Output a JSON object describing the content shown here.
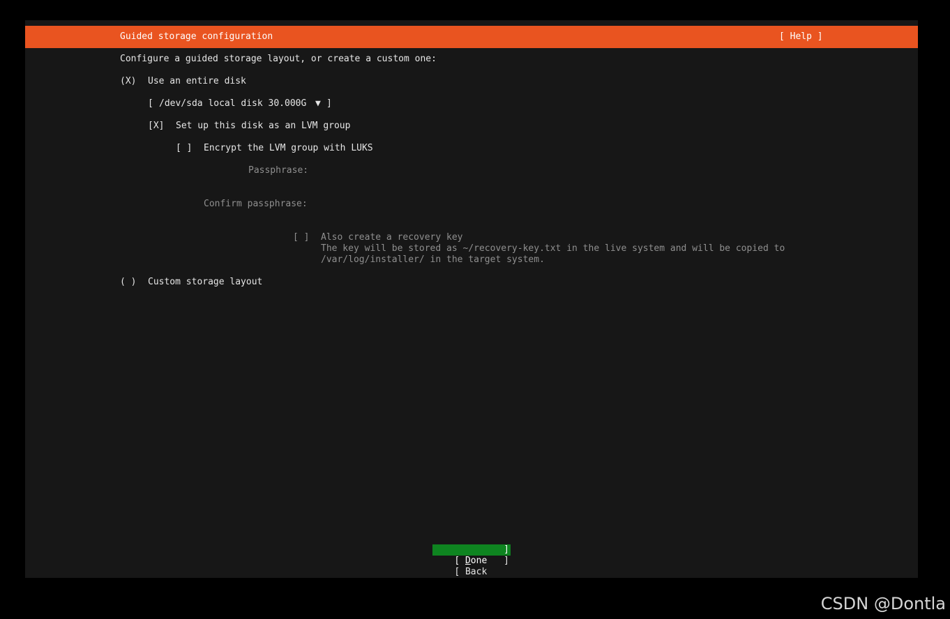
{
  "header": {
    "title": "Guided storage configuration",
    "help_label": "[ Help ]"
  },
  "body": {
    "intro": "Configure a guided storage layout, or create a custom one:",
    "entire_disk": {
      "marker": "(X)",
      "label": "Use an entire disk"
    },
    "disk_select": {
      "open": "[",
      "value": "/dev/sda local disk 30.000G",
      "arrow": "▼",
      "close": "]"
    },
    "lvm": {
      "marker": "[X]",
      "label": "Set up this disk as an LVM group"
    },
    "luks": {
      "marker": "[ ]",
      "label": "Encrypt the LVM group with LUKS"
    },
    "passphrase_label": "Passphrase:",
    "confirm_passphrase_label": "Confirm passphrase:",
    "recovery": {
      "marker": "[ ]",
      "label": "Also create a recovery key",
      "help_line1": "The key will be stored as ~/recovery-key.txt in the live system and will be copied to",
      "help_line2": "/var/log/installer/ in the target system."
    },
    "custom_layout": {
      "marker": "( )",
      "label": "Custom storage layout"
    }
  },
  "buttons": {
    "done": {
      "open": "[ ",
      "hotkey": "D",
      "rest": "one",
      "close": "]"
    },
    "back": {
      "open": "[ ",
      "label": "Back",
      "close": "]"
    }
  },
  "watermark": "CSDN @Dontla",
  "colors": {
    "accent": "#e95420",
    "focus_button": "#0e8420",
    "background": "#171717"
  }
}
